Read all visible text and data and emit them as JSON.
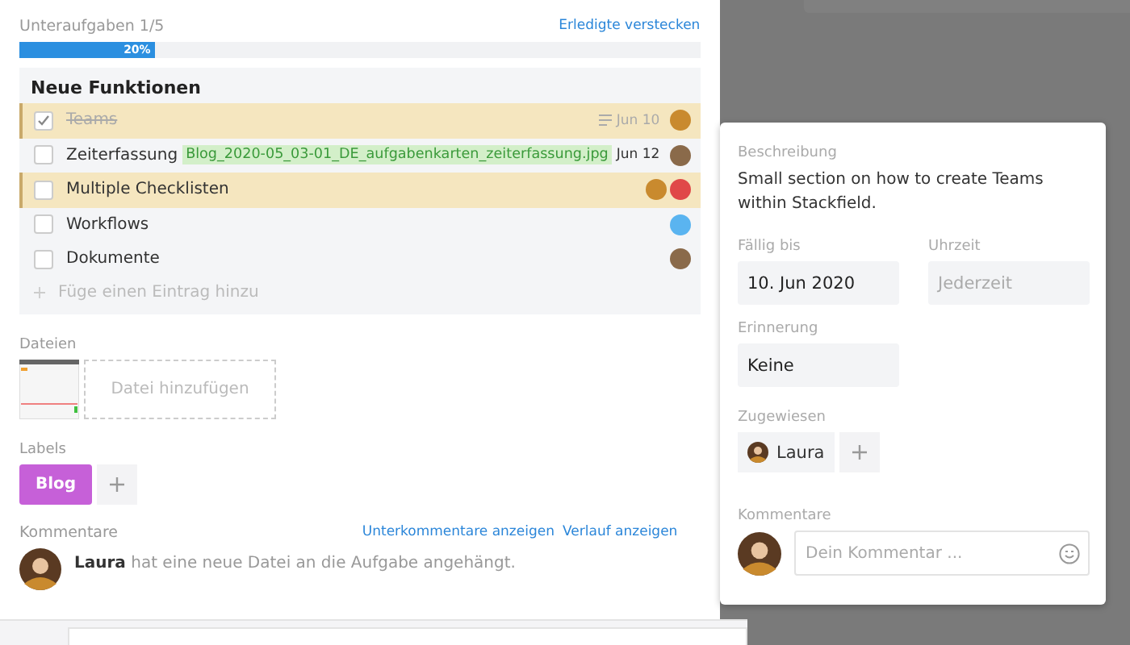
{
  "subtasks": {
    "label": "Unteraufgaben 1/5",
    "hide_link": "Erledigte verstecken",
    "level": 0.2,
    "percent": "20%"
  },
  "checklist": {
    "title": "Neue Funktionen",
    "items": [
      {
        "label": "Teams",
        "checked": true,
        "highlighted": true,
        "has_description": true,
        "date": "Jun 10",
        "avatars": [
          {
            "color": "#c98a2e"
          }
        ]
      },
      {
        "label": "Zeiterfassung",
        "attachment": "Blog_2020-05_03-01_DE_aufgabenkarten_zeiterfassung.jpg",
        "checked": false,
        "highlighted": false,
        "has_description": false,
        "date": "Jun 12",
        "avatars": [
          {
            "color": "#8a6a4a"
          }
        ]
      },
      {
        "label": "Multiple Checklisten",
        "checked": false,
        "highlighted": true,
        "has_description": false,
        "avatars": [
          {
            "color": "#c98a2e"
          },
          {
            "color": "#e04848"
          }
        ]
      },
      {
        "label": "Workflows",
        "checked": false,
        "highlighted": false,
        "has_description": false,
        "avatars": [
          {
            "color": "#5ab4f0"
          }
        ]
      },
      {
        "label": "Dokumente",
        "checked": false,
        "highlighted": false,
        "has_description": false,
        "avatars": [
          {
            "color": "#8a6a4a"
          }
        ]
      }
    ],
    "add_placeholder": "Füge einen Eintrag hinzu"
  },
  "files": {
    "label": "Dateien",
    "add": "Datei hinzufügen"
  },
  "labels": {
    "label": "Labels",
    "items": [
      {
        "text": "Blog",
        "color": "#c660d8"
      }
    ]
  },
  "comments": {
    "label": "Kommentare",
    "links": [
      "Unterkommentare anzeigen",
      "Verlauf anzeigen"
    ],
    "entries": [
      {
        "author": "Laura",
        "text": "hat eine neue Datei an die Aufgabe angehängt."
      }
    ]
  },
  "popup": {
    "description_label": "Beschreibung",
    "description": "Small section on how to create Teams within Stackfield.",
    "due_label": "Fällig bis",
    "due": "10. Jun 2020",
    "time_label": "Uhrzeit",
    "time_placeholder": "Jederzeit",
    "reminder_label": "Erinnerung",
    "reminder": "Keine",
    "assigned_label": "Zugewiesen",
    "assignees": [
      "Laura"
    ],
    "comments_label": "Kommentare",
    "comment_placeholder": "Dein Kommentar ..."
  }
}
